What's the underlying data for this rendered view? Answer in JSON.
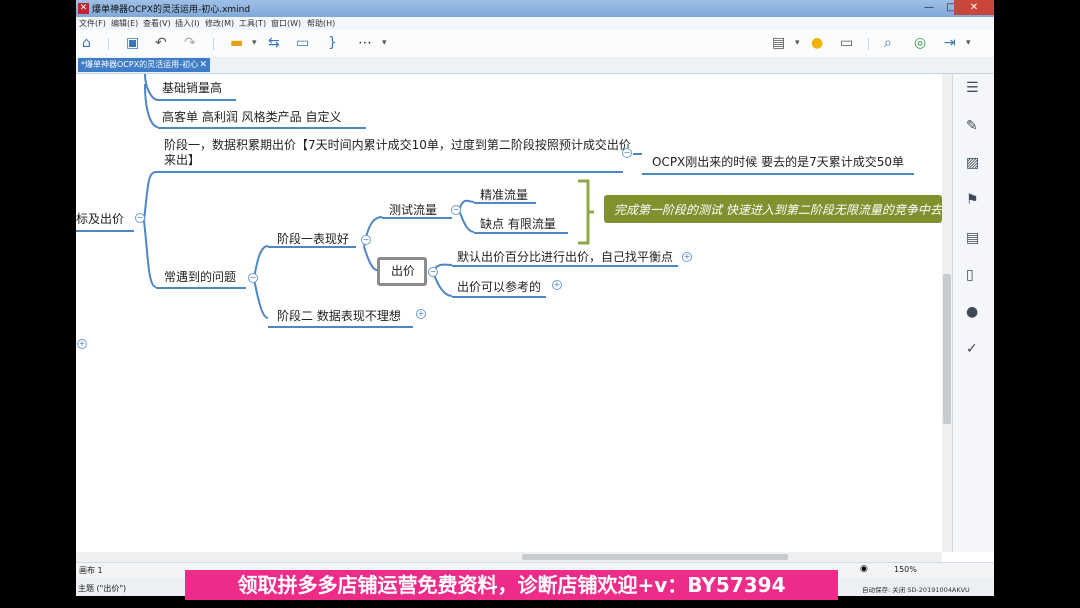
{
  "window": {
    "title": "爆单神器OCPX的灵活运用-初心.xmind",
    "app_icon": "xmind-icon",
    "controls": {
      "minimize": "—",
      "maximize": "□",
      "close": "✕"
    }
  },
  "menu": [
    "文件(F)",
    "编辑(E)",
    "查看(V)",
    "插入(I)",
    "修改(M)",
    "工具(T)",
    "窗口(W)",
    "帮助(H)"
  ],
  "toolbar": {
    "icons": [
      "home-icon",
      "save-icon",
      "undo-icon",
      "redo-icon",
      "topic-icon",
      "relationship-icon",
      "boundary-icon",
      "summary-icon",
      "more-icon",
      "presentation-icon",
      "brainstorm-icon",
      "gantt-icon",
      "search-icon",
      "share-icon",
      "export-icon"
    ]
  },
  "tab": {
    "label": "*爆单神器OCPX的灵活运用-初心",
    "close": "✕"
  },
  "mindmap": {
    "nodes": {
      "base_sales": "基础销量高",
      "product_types": "高客单  高利润  风格类产品   自定义",
      "stage_one": "阶段一，数据积累期出价【7天时间内累计成交10单，过度到第二阶段按照预计成交出价来出】",
      "ocpx_note": "OCPX刚出来的时候 要去的是7天累计成交50单",
      "parent_cut": "标及出价",
      "common_problems": "常遇到的问题",
      "stage_one_good": "阶段一表现好",
      "test_traffic": "测试流量",
      "precise_traffic": "精准流量",
      "drawback": "缺点  有限流量",
      "bid": "出价",
      "default_bid": "默认出价百分比进行出价，自己找平衡点",
      "bid_reference": "出价可以参考的",
      "stage_two": "阶段二  数据表现不理想"
    },
    "callout": "完成第一阶段的测试 快速进入到第二阶段无限流量的竞争中去",
    "collapse_symbol": "−",
    "expand_symbol": "+"
  },
  "right_panel_icons": [
    "outline-icon",
    "format-brush-icon",
    "image-icon",
    "flag-marker-icon",
    "notes-icon",
    "document-icon",
    "comment-icon",
    "task-icon"
  ],
  "sheet": {
    "tab": "画布 1",
    "zoom": "150%"
  },
  "status": {
    "left": "主题 (\"出价\")",
    "right": "自动保存: 关闭   SD-20191004AKVU"
  },
  "promo": "领取拼多多店铺运营免费资料，诊断店铺欢迎+v：BY57394",
  "colors": {
    "branch": "#4f86c6",
    "callout": "#80922f",
    "promo": "#ed2b89"
  }
}
